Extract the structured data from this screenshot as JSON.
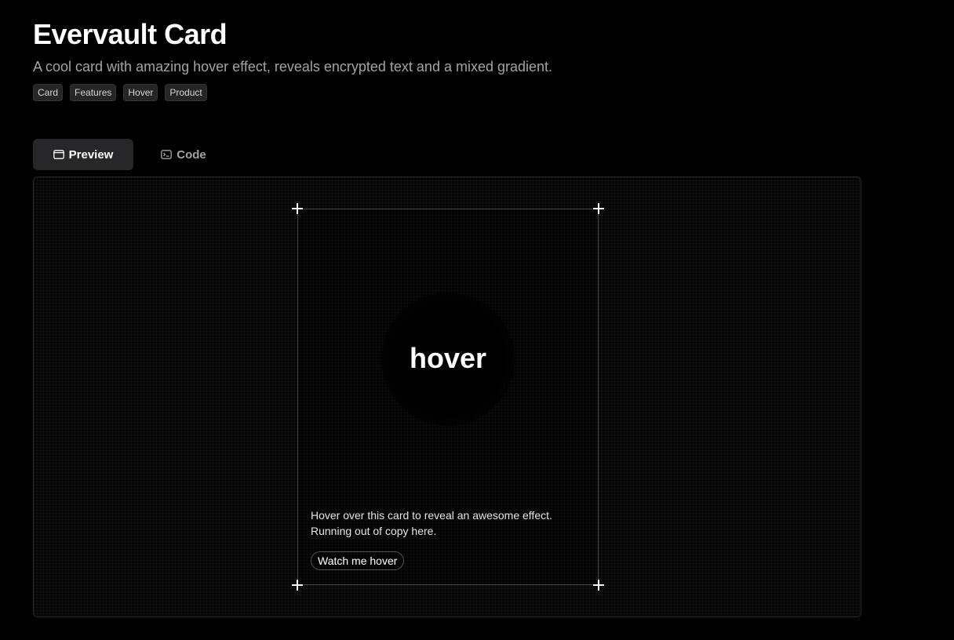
{
  "header": {
    "title": "Evervault Card",
    "subtitle": "A cool card with amazing hover effect, reveals encrypted text and a mixed gradient.",
    "tags": [
      "Card",
      "Features",
      "Hover",
      "Product"
    ]
  },
  "tabs": [
    {
      "label": "Preview",
      "icon": "preview-window-icon",
      "active": true
    },
    {
      "label": "Code",
      "icon": "terminal-icon",
      "active": false
    }
  ],
  "card": {
    "hover_text": "hover",
    "description": "Hover over this card to reveal an awesome effect. Running out of copy here.",
    "button_label": "Watch me hover"
  },
  "colors": {
    "background": "#000000",
    "text_primary": "#ffffff",
    "text_muted": "#a3a3a3",
    "tab_active_bg": "#27272a",
    "tag_bg": "#262626"
  }
}
